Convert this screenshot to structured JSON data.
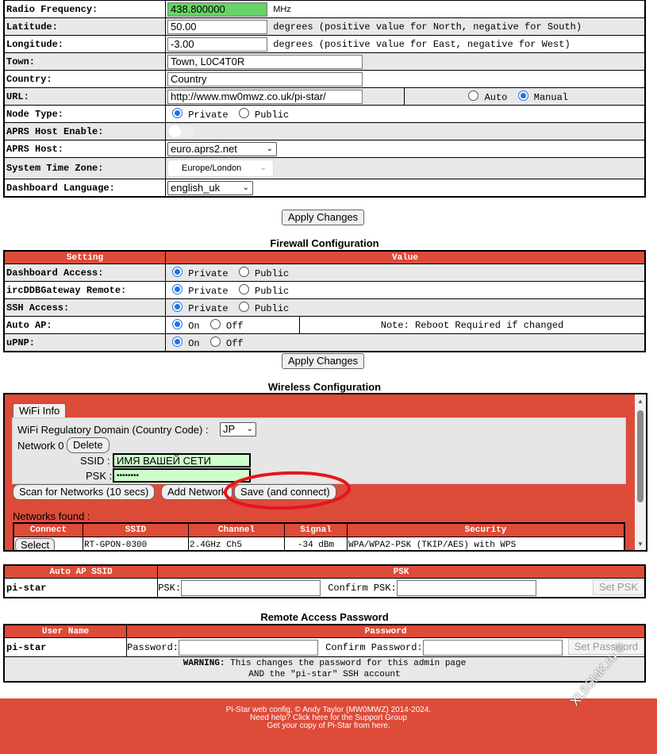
{
  "general": {
    "radio_frequency": {
      "label": "Radio Frequency:",
      "value": "438.800000",
      "unit": "MHz"
    },
    "latitude": {
      "label": "Latitude:",
      "value": "50.00",
      "hint": "degrees (positive value for North, negative for South)"
    },
    "longitude": {
      "label": "Longitude:",
      "value": "-3.00",
      "hint": "degrees (positive value for East, negative for West)"
    },
    "town": {
      "label": "Town:",
      "value": "Town, L0C4T0R"
    },
    "country": {
      "label": "Country:",
      "value": "Country"
    },
    "url": {
      "label": "URL:",
      "value": "http://www.mw0mwz.co.uk/pi-star/",
      "auto": "Auto",
      "manual": "Manual"
    },
    "node_type": {
      "label": "Node Type:",
      "private": "Private",
      "public": "Public"
    },
    "aprs_enable": {
      "label": "APRS Host Enable:"
    },
    "aprs_host": {
      "label": "APRS Host:",
      "value": "euro.aprs2.net"
    },
    "timezone": {
      "label": "System Time Zone:",
      "value": "Europe/London"
    },
    "language": {
      "label": "Dashboard Language:",
      "value": "english_uk"
    },
    "apply": "Apply Changes"
  },
  "firewall": {
    "title": "Firewall Configuration",
    "col_setting": "Setting",
    "col_value": "Value",
    "dashboard": {
      "label": "Dashboard Access:",
      "private": "Private",
      "public": "Public"
    },
    "ircddb": {
      "label": "ircDDBGateway Remote:",
      "private": "Private",
      "public": "Public"
    },
    "ssh": {
      "label": "SSH Access:",
      "private": "Private",
      "public": "Public"
    },
    "autoap": {
      "label": "Auto AP:",
      "on": "On",
      "off": "Off",
      "note": "Note: Reboot Required if changed"
    },
    "upnp": {
      "label": "uPNP:",
      "on": "On",
      "off": "Off"
    },
    "apply": "Apply Changes"
  },
  "wireless": {
    "title": "Wireless Configuration",
    "wifi_info": "WiFi Info",
    "reg_domain_label": "WiFi Regulatory Domain (Country Code) :",
    "reg_domain_value": "JP",
    "network_label": "Network 0",
    "delete": "Delete",
    "ssid_label": "SSID :",
    "ssid_value": "ИМЯ ВАШЕЙ СЕТИ",
    "psk_label": "PSK :",
    "psk_value": "••••••••",
    "scan": "Scan for Networks (10 secs)",
    "add": "Add Network",
    "save": "Save (and connect)",
    "networks_found": "Networks found :",
    "headers": [
      "Connect",
      "SSID",
      "Channel",
      "Signal",
      "Security"
    ],
    "row": {
      "select": "Select",
      "ssid": "RT-GPON-0300",
      "channel": "2.4GHz Ch5",
      "signal": "-34 dBm",
      "security": "WPA/WPA2-PSK (TKIP/AES) with WPS"
    }
  },
  "autoap": {
    "col_ssid": "Auto AP SSID",
    "col_psk": "PSK",
    "ssid": "pi-star",
    "psk_label": "PSK:",
    "confirm_label": "Confirm PSK:",
    "button": "Set PSK"
  },
  "remote": {
    "title": "Remote Access Password",
    "col_user": "User Name",
    "col_password": "Password",
    "user": "pi-star",
    "password_label": "Password:",
    "confirm_label": "Confirm Password:",
    "button": "Set Password",
    "warning_bold": "WARNING:",
    "warning_1": " This changes the password for this admin page",
    "warning_2": "AND the \"pi-star\" SSH account"
  },
  "footer": {
    "line1": "Pi-Star web config, © Andy Taylor (MW0MWZ) 2014-2024.",
    "line2_prefix": "Need help? Click ",
    "line2_link": "here for the Support Group",
    "line3_prefix": "Get your copy of Pi-Star from ",
    "line3_link": "here",
    "line3_suffix": "."
  },
  "watermark": "XL5SMK.ru ©",
  "colors": {
    "accent": "#dd4b39",
    "highlight": "#66d466",
    "annotation": "#e8141b"
  }
}
